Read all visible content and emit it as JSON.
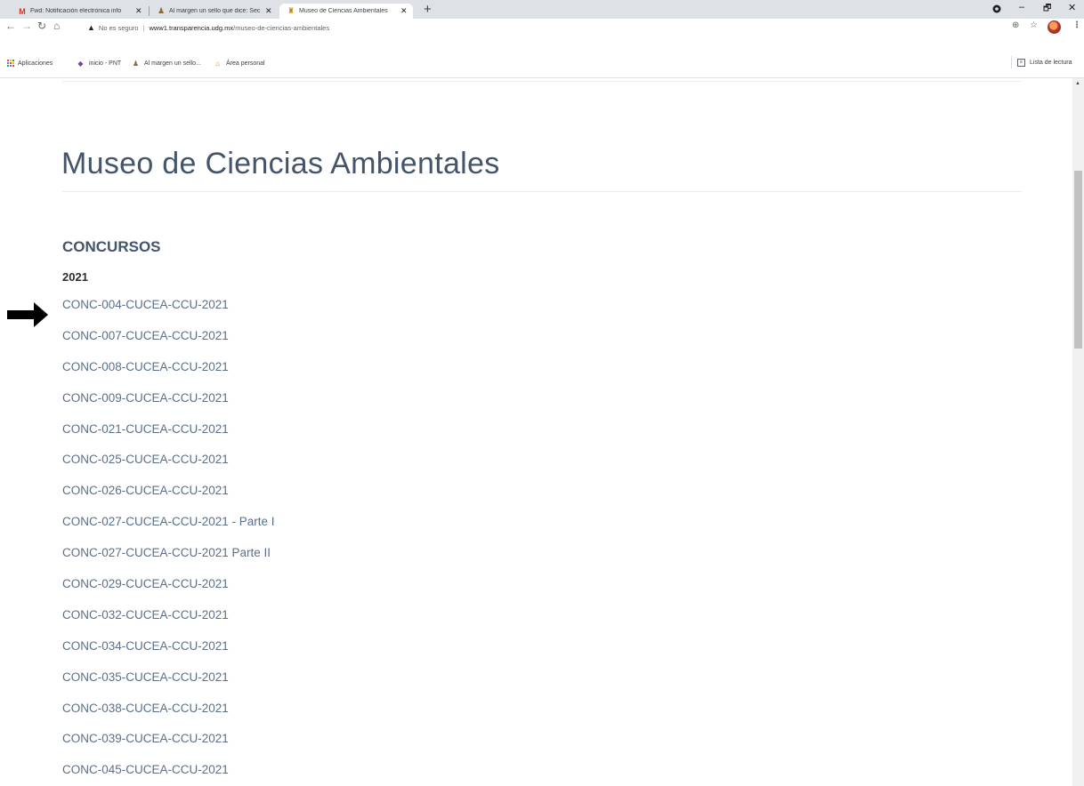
{
  "browser": {
    "tabs": [
      {
        "icon": "gmail-icon",
        "title": "Fwd: Notificación electrónica info"
      },
      {
        "icon": "shield-crest-icon",
        "title": "Al margen un sello que dice: Sec"
      },
      {
        "icon": "museum-icon",
        "title": "Museo de Ciencias Ambientales"
      }
    ],
    "new_tab": "+",
    "close_glyph": "✕",
    "window_controls": {
      "minimize": "–",
      "restore": "🗗",
      "close": "✕"
    },
    "address": {
      "security_label": "No es seguro",
      "host": "www1.transparencia.udg.mx",
      "path": "/museo-de-ciencias-ambientales"
    },
    "bookmarks": [
      {
        "icon": "apps-grid-icon",
        "label": "Aplicaciones"
      },
      {
        "icon": "pnt-icon",
        "label": "inicio - PNT"
      },
      {
        "icon": "shield-crest-icon",
        "label": "Al margen un sello..."
      },
      {
        "icon": "home-icon",
        "label": "Área personal"
      }
    ],
    "reading_list": "Lista de lectura"
  },
  "page": {
    "title": "Museo de Ciencias Ambientales",
    "section_title": "CONCURSOS",
    "year": "2021",
    "links": [
      "CONC-004-CUCEA-CCU-2021",
      "CONC-007-CUCEA-CCU-2021",
      "CONC-008-CUCEA-CCU-2021",
      "CONC-009-CUCEA-CCU-2021",
      "CONC-021-CUCEA-CCU-2021",
      "CONC-025-CUCEA-CCU-2021",
      "CONC-026-CUCEA-CCU-2021",
      "CONC-027-CUCEA-CCU-2021 - Parte I",
      "CONC-027-CUCEA-CCU-2021 Parte II",
      "CONC-029-CUCEA-CCU-2021",
      "CONC-032-CUCEA-CCU-2021",
      "CONC-034-CUCEA-CCU-2021",
      "CONC-035-CUCEA-CCU-2021",
      "CONC-038-CUCEA-CCU-2021",
      "CONC-039-CUCEA-CCU-2021",
      "CONC-045-CUCEA-CCU-2021"
    ]
  },
  "colors": {
    "title": "#44546a",
    "link": "#5a7089",
    "tabstrip": "#dee1e6"
  }
}
